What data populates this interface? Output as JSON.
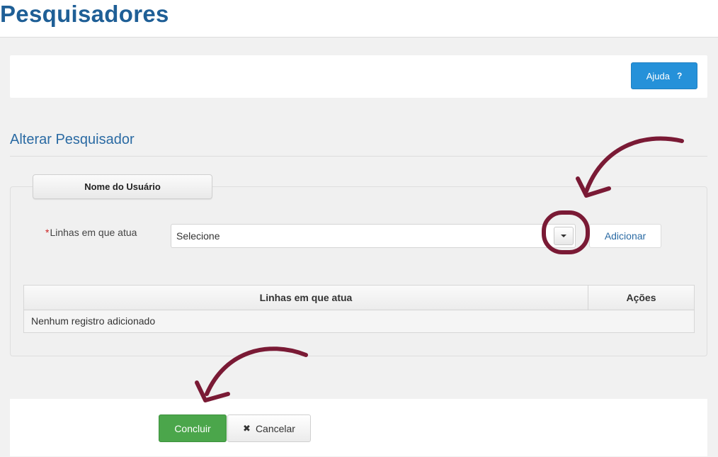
{
  "page": {
    "title": "Pesquisadores"
  },
  "toolbar": {
    "help_label": "Ajuda",
    "help_icon_glyph": "?",
    "help_icon": "question-icon",
    "accent": "#2591d9"
  },
  "form": {
    "title": "Alterar Pesquisador",
    "legend": "Nome do Usuário",
    "field_label": "Linhas em que atua",
    "required_mark": "*",
    "select_value": "Selecione",
    "caret_icon": "caret-down-icon",
    "add_label": "Adicionar"
  },
  "table": {
    "columns": [
      "Linhas em que atua",
      "Ações"
    ],
    "empty_message": "Nenhum registro adicionado"
  },
  "actions": {
    "ok_label": "Concluir",
    "ok_color": "#4ba64b",
    "cancel_label": "Cancelar",
    "cancel_icon_glyph": "✖",
    "cancel_icon": "times-icon"
  },
  "annotations": {
    "color": "#7a1a35"
  }
}
